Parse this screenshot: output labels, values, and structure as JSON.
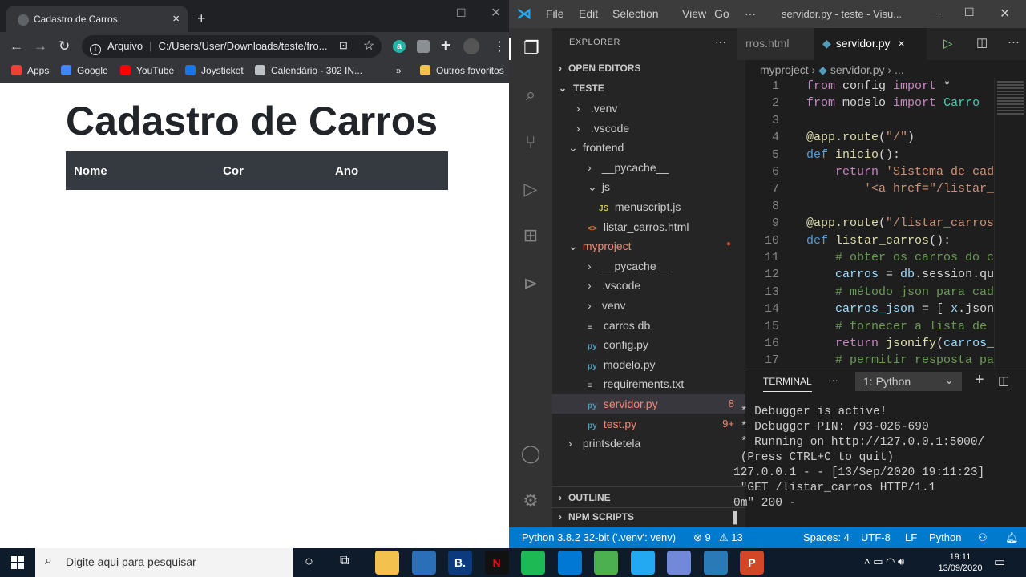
{
  "chrome": {
    "tab_title": "Cadastro de Carros",
    "new_tab": "+",
    "address_prefix": "Arquivo",
    "address_url": "C:/Users/User/Downloads/teste/fro...",
    "bookmarks": [
      {
        "label": "Apps",
        "color": "#ea4335"
      },
      {
        "label": "Google",
        "color": "#4285f4"
      },
      {
        "label": "YouTube",
        "color": "#ff0000"
      },
      {
        "label": "Joysticket",
        "color": "#1a73e8"
      },
      {
        "label": "Calendário - 302 IN...",
        "color": "#bdc1c6"
      }
    ],
    "more_bookmarks": "»",
    "other_favorites": "Outros favoritos"
  },
  "page": {
    "title": "Cadastro de Carros",
    "table_headers": [
      "Nome",
      "Cor",
      "Ano"
    ]
  },
  "vscode": {
    "menu": [
      "File",
      "Edit",
      "Selection",
      "View",
      "Go",
      "···"
    ],
    "window_title": "servidor.py - teste - Visu...",
    "explorer_label": "EXPLORER",
    "explorer_more": "···",
    "sections": {
      "open_editors": "OPEN EDITORS",
      "workspace": "TESTE",
      "outline": "OUTLINE",
      "npm": "NPM SCRIPTS"
    },
    "tree": [
      {
        "label": ".venv",
        "chev": "›",
        "indent": 0
      },
      {
        "label": ".vscode",
        "chev": "›",
        "indent": 0
      },
      {
        "label": "frontend",
        "chev": "⌄",
        "indent": -1
      },
      {
        "label": "__pycache__",
        "chev": "›",
        "indent": 1
      },
      {
        "label": "js",
        "chev": "⌄",
        "indent": 1
      },
      {
        "label": "menuscript.js",
        "chev": "",
        "indent": 2,
        "icon": "JS",
        "icon_color": "#cbcb41"
      },
      {
        "label": "listar_carros.html",
        "chev": "",
        "indent": 1,
        "icon": "<>",
        "icon_color": "#e37933"
      },
      {
        "label": "myproject",
        "chev": "⌄",
        "indent": -1,
        "color": "#f48771",
        "badge": "●",
        "badge_color": "#c74e39"
      },
      {
        "label": "__pycache__",
        "chev": "›",
        "indent": 1
      },
      {
        "label": ".vscode",
        "chev": "›",
        "indent": 1
      },
      {
        "label": "venv",
        "chev": "›",
        "indent": 1
      },
      {
        "label": "carros.db",
        "chev": "",
        "indent": 1,
        "icon": "≡",
        "icon_color": "#ccc"
      },
      {
        "label": "config.py",
        "chev": "",
        "indent": 1,
        "icon": "py",
        "icon_color": "#519aba"
      },
      {
        "label": "modelo.py",
        "chev": "",
        "indent": 1,
        "icon": "py",
        "icon_color": "#519aba"
      },
      {
        "label": "requirements.txt",
        "chev": "",
        "indent": 1,
        "icon": "≡",
        "icon_color": "#ccc"
      },
      {
        "label": "servidor.py",
        "chev": "",
        "indent": 1,
        "icon": "py",
        "icon_color": "#519aba",
        "color": "#f48771",
        "badge": "8",
        "badge_color": "#f48771",
        "selected": true
      },
      {
        "label": "test.py",
        "chev": "",
        "indent": 1,
        "icon": "py",
        "icon_color": "#519aba",
        "color": "#f48771",
        "badge": "9+",
        "badge_color": "#f48771"
      },
      {
        "label": "printsdetela",
        "chev": "›",
        "indent": -1
      }
    ],
    "tabs": {
      "prev": "rros.html",
      "active": "servidor.py",
      "close": "×"
    },
    "breadcrumb": {
      "folder": "myproject",
      "sep": "›",
      "file": "servidor.py",
      "tail": "› ..."
    },
    "code": [
      {
        "n": "1",
        "html": "<span class='kw'>from</span> config <span class='kw'>import</span> *"
      },
      {
        "n": "2",
        "html": "<span class='kw'>from</span> modelo <span class='kw'>import</span> <span class='cl'>Carro</span>"
      },
      {
        "n": "3",
        "html": ""
      },
      {
        "n": "4",
        "html": "<span class='fn'>@app.route</span>(<span class='st'>\"/\"</span>)"
      },
      {
        "n": "5",
        "html": "<span class='kb'>def</span> <span class='fn'>inicio</span>():"
      },
      {
        "n": "6",
        "html": "    <span class='kw'>return</span> <span class='st'>'Sistema de cada</span>"
      },
      {
        "n": "7",
        "html": "        <span class='st'>'&lt;a href=\"/listar_c</span>"
      },
      {
        "n": "8",
        "html": ""
      },
      {
        "n": "9",
        "html": "<span class='fn'>@app.route</span>(<span class='st'>\"/listar_carros\"</span>"
      },
      {
        "n": "10",
        "html": "<span class='kb'>def</span> <span class='fn'>listar_carros</span>():"
      },
      {
        "n": "11",
        "html": "    <span class='cm'># obter os carros do ca</span>"
      },
      {
        "n": "12",
        "html": "    <span class='vr'>carros</span> = <span class='vr'>db</span>.session.que"
      },
      {
        "n": "13",
        "html": "    <span class='cm'># método json para cada</span>"
      },
      {
        "n": "14",
        "html": "    <span class='vr'>carros_json</span> = [ <span class='vr'>x</span>.json("
      },
      {
        "n": "15",
        "html": "    <span class='cm'># fornecer a lista de c</span>"
      },
      {
        "n": "16",
        "html": "    <span class='kw'>return</span> <span class='fn'>jsonify</span>(<span class='vr'>carros_j</span>"
      },
      {
        "n": "17",
        "html": "    <span class='cm'># permitir resposta par</span>"
      }
    ],
    "terminal": {
      "tab": "TERMINAL",
      "more": "···",
      "dropdown": "1: Python",
      "output": [
        " * Debugger is active!",
        " * Debugger PIN: 793-026-690",
        " * Running on http://127.0.0.1:5000/",
        " (Press CTRL+C to quit)",
        "127.0.0.1 - - [13/Sep/2020 19:11:23]",
        " \"GET /listar_carros HTTP/1.1",
        "0m\" 200 -",
        "▌"
      ]
    },
    "status": {
      "python": "Python 3.8.2 32-bit ('.venv': venv)",
      "errors": "⊗ 9",
      "warnings": "⚠ 13",
      "spaces": "Spaces: 4",
      "encoding": "UTF-8",
      "eol": "LF",
      "language": "Python"
    }
  },
  "taskbar": {
    "search_placeholder": "Digite aqui para pesquisar",
    "time": "19:11",
    "date": "13/09/2020",
    "apps": [
      {
        "name": "file-explorer-icon",
        "color": "#f2c14e"
      },
      {
        "name": "store-icon",
        "color": "#2b6fb8"
      },
      {
        "name": "booking-icon",
        "color": "#0b3a7e",
        "text": "B."
      },
      {
        "name": "netflix-icon",
        "color": "#111",
        "text": "N",
        "fg": "#e50914"
      },
      {
        "name": "spotify-icon",
        "color": "#1db954"
      },
      {
        "name": "mail-icon",
        "color": "#0078d4"
      },
      {
        "name": "chrome-icon",
        "color": "#4caf50"
      },
      {
        "name": "vscode-icon",
        "color": "#23a9f2"
      },
      {
        "name": "discord-icon",
        "color": "#7289da"
      },
      {
        "name": "photos-icon",
        "color": "#2a7ab8"
      },
      {
        "name": "powerpoint-icon",
        "color": "#d24726",
        "text": "P"
      }
    ]
  }
}
